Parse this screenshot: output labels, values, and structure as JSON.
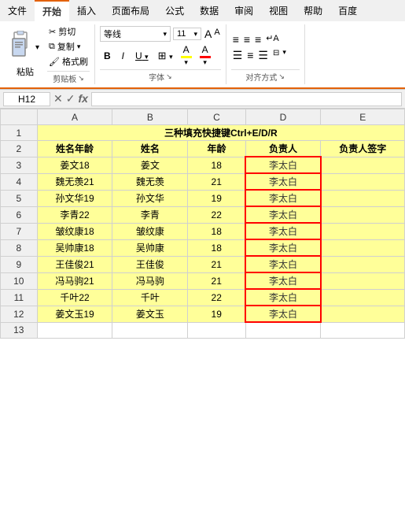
{
  "ribbon": {
    "tabs": [
      "文件",
      "开始",
      "插入",
      "页面布局",
      "公式",
      "数据",
      "审阅",
      "视图",
      "帮助",
      "百度"
    ],
    "active_tab": "开始",
    "groups": {
      "clipboard": {
        "label": "剪贴板",
        "paste": "粘贴",
        "items": [
          "✂ 剪切",
          "🗐 复制 ▾",
          "🖌 格式刷"
        ]
      },
      "font": {
        "label": "字体",
        "name": "等线",
        "size": "11",
        "bold": "B",
        "italic": "I",
        "underline": "U",
        "border_icon": "⊞",
        "highlight_color": "#ffff00",
        "font_color": "#ff0000"
      },
      "alignment": {
        "label": "对齐方式"
      }
    }
  },
  "formula_bar": {
    "cell_ref": "H12",
    "formula": ""
  },
  "columns": {
    "headers": [
      "A",
      "B",
      "C",
      "D",
      "E"
    ],
    "labels": [
      "姓名年龄",
      "姓名",
      "年龄",
      "负责人",
      "负责人签字"
    ]
  },
  "title_row": "三种填充快捷键Ctrl+E/D/R",
  "rows": [
    {
      "num": 3,
      "a": "姜文18",
      "b": "姜文",
      "c": "18",
      "d": "李太白",
      "e": ""
    },
    {
      "num": 4,
      "a": "魏无羡21",
      "b": "魏无羡",
      "c": "21",
      "d": "李太白",
      "e": ""
    },
    {
      "num": 5,
      "a": "孙文华19",
      "b": "孙文华",
      "c": "19",
      "d": "李太白",
      "e": ""
    },
    {
      "num": 6,
      "a": "李青22",
      "b": "李青",
      "c": "22",
      "d": "李太白",
      "e": ""
    },
    {
      "num": 7,
      "a": "皱纹康18",
      "b": "皱纹康",
      "c": "18",
      "d": "李太白",
      "e": ""
    },
    {
      "num": 8,
      "a": "吴帅康18",
      "b": "吴帅康",
      "c": "18",
      "d": "李太白",
      "e": ""
    },
    {
      "num": 9,
      "a": "王佳俊21",
      "b": "王佳俊",
      "c": "21",
      "d": "李太白",
      "e": ""
    },
    {
      "num": 10,
      "a": "冯马驹21",
      "b": "冯马驹",
      "c": "21",
      "d": "李太白",
      "e": ""
    },
    {
      "num": 11,
      "a": "千叶22",
      "b": "千叶",
      "c": "22",
      "d": "李太白",
      "e": ""
    },
    {
      "num": 12,
      "a": "姜文玉19",
      "b": "姜文玉",
      "c": "19",
      "d": "李太白",
      "e": ""
    }
  ]
}
